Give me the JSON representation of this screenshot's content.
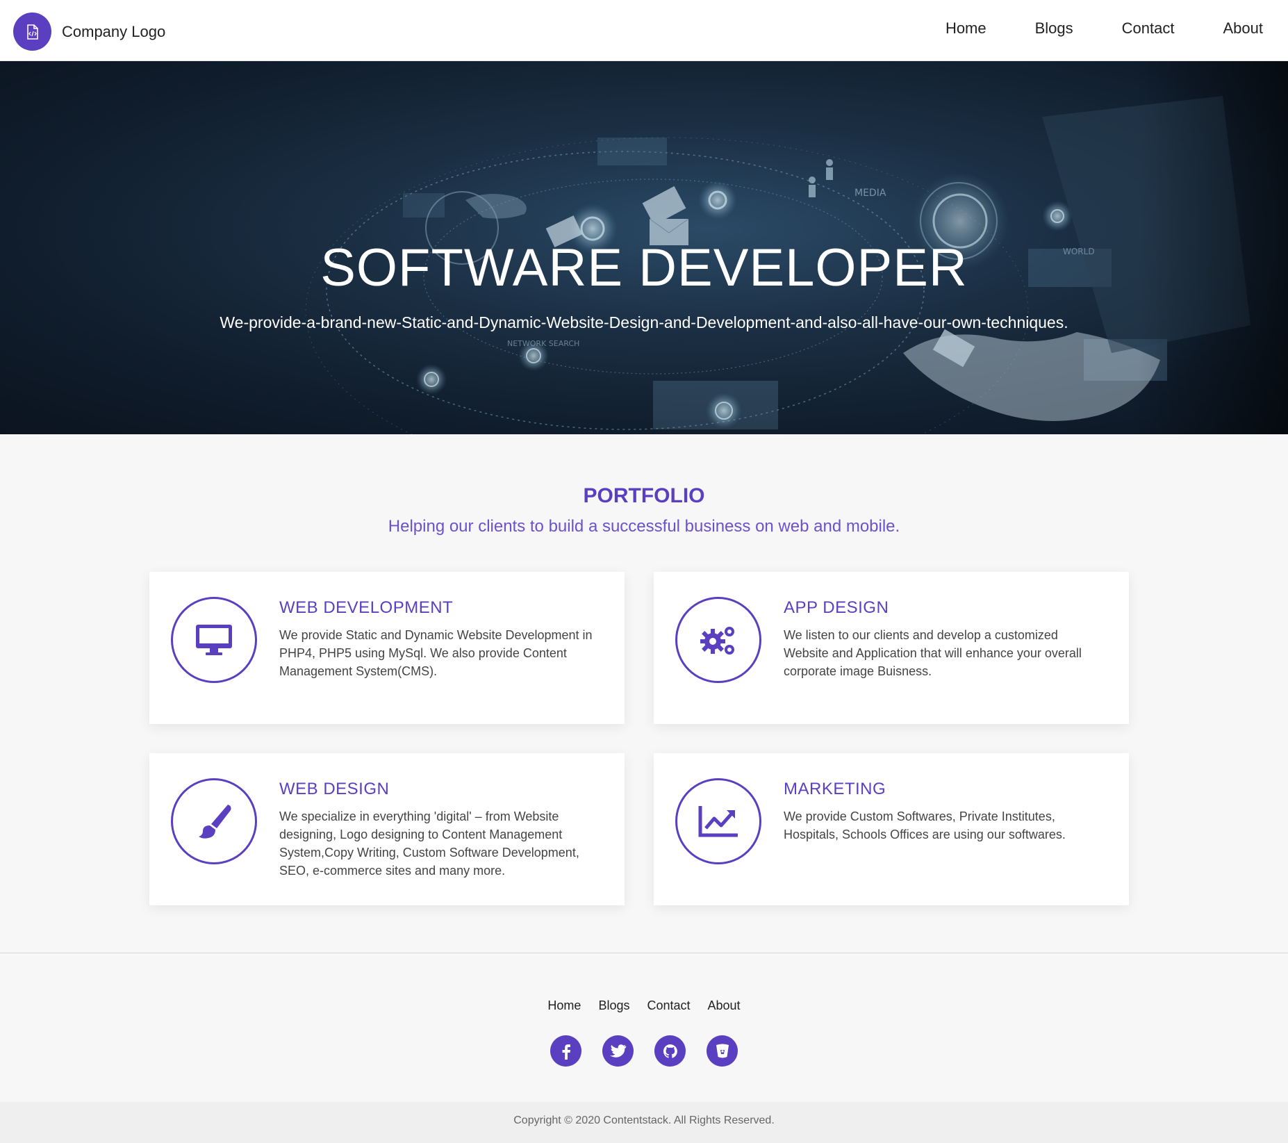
{
  "header": {
    "logo_text": "Company Logo",
    "nav": [
      "Home",
      "Blogs",
      "Contact",
      "About"
    ]
  },
  "hero": {
    "title": "SOFTWARE DEVELOPER",
    "subtitle": "We-provide-a-brand-new-Static-and-Dynamic-Website-Design-and-Development-and-also-all-have-our-own-techniques.",
    "background_words": [
      "MEDIA",
      "WORLD",
      "NETWORK SEARCH"
    ]
  },
  "portfolio": {
    "title": "PORTFOLIO",
    "subtitle": "Helping our clients to build a successful business on web and mobile.",
    "cards": [
      {
        "icon": "monitor-icon",
        "title": "WEB DEVELOPMENT",
        "text": "We provide Static and Dynamic Website Development in PHP4, PHP5 using MySql. We also provide Content Management System(CMS)."
      },
      {
        "icon": "gears-icon",
        "title": "APP DESIGN",
        "text": "We listen to our clients and develop a customized Website and Application that will enhance your overall corporate image Buisness."
      },
      {
        "icon": "paintbrush-icon",
        "title": "WEB DESIGN",
        "text": "We specialize in everything 'digital' – from Website designing, Logo designing to Content Management System,Copy Writing, Custom Software Development, SEO, e-commerce sites and many more."
      },
      {
        "icon": "chart-line-icon",
        "title": "MARKETING",
        "text": "We provide Custom Softwares, Private Institutes, Hospitals, Schools Offices are using our softwares."
      }
    ]
  },
  "footer": {
    "nav": [
      "Home",
      "Blogs",
      "Contact",
      "About"
    ],
    "socials": [
      "facebook-icon",
      "twitter-icon",
      "github-icon",
      "bucket-icon"
    ],
    "copyright": "Copyright © 2020 Contentstack. All Rights Reserved."
  },
  "colors": {
    "accent": "#5a3fc0",
    "page_bg": "#f7f7f7",
    "card_bg": "#ffffff"
  }
}
